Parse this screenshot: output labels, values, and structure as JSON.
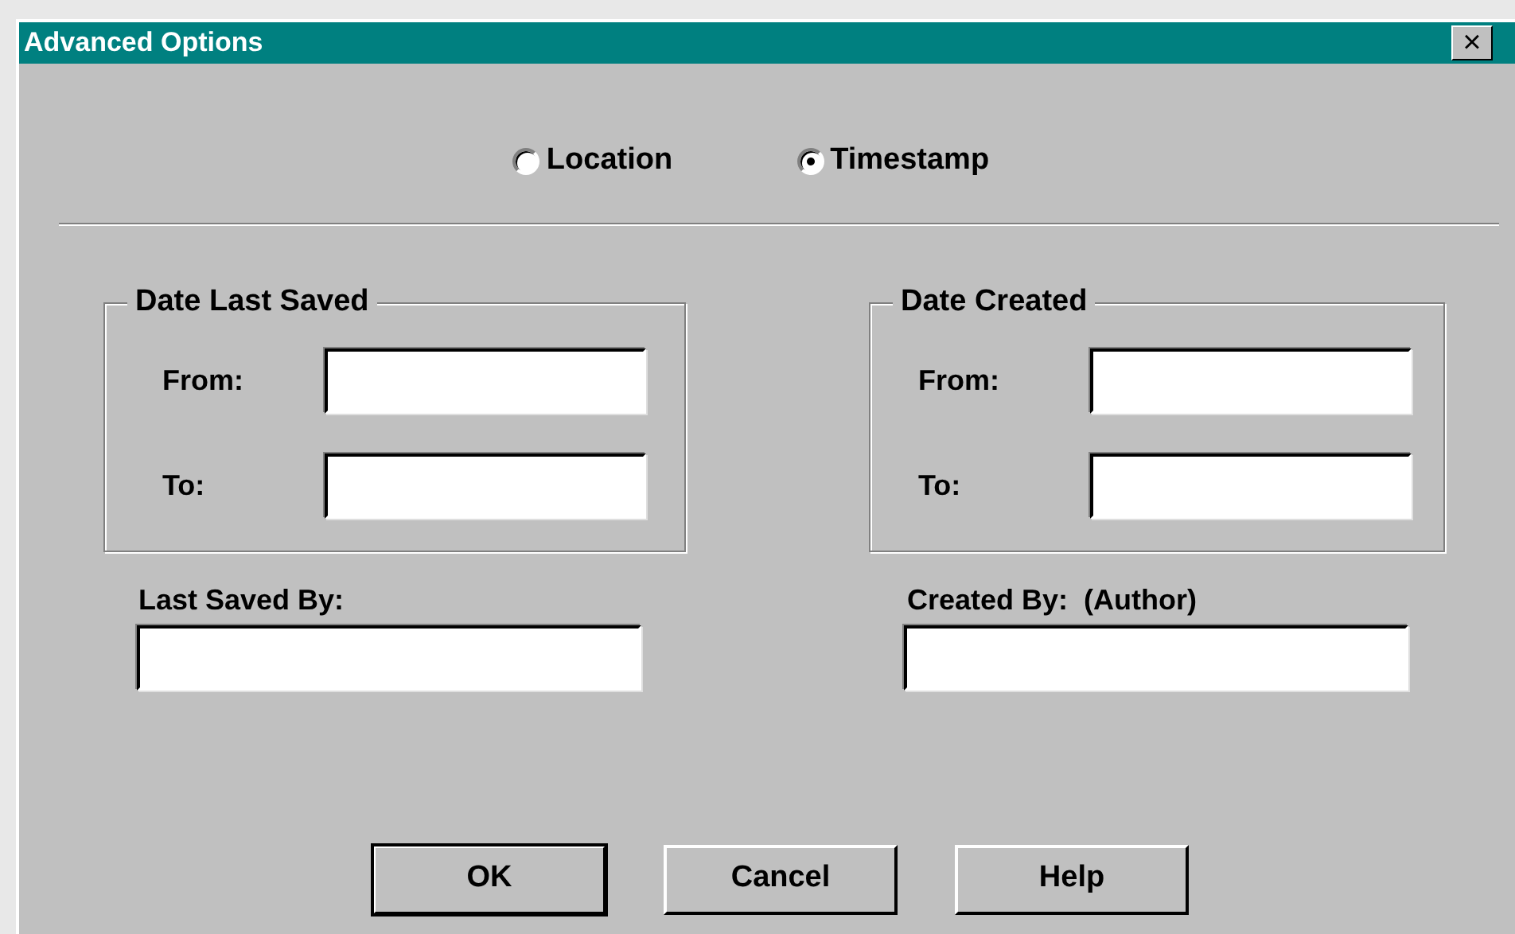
{
  "window": {
    "title": "Advanced Options",
    "close": "×"
  },
  "search_by": [
    {
      "label": "Location",
      "selected": false
    },
    {
      "label": "Timestamp",
      "selected": true
    }
  ],
  "groups": [
    {
      "title": "Date Last Saved",
      "fields": [
        {
          "label": "From:"
        },
        {
          "label": "To:"
        }
      ],
      "person": {
        "label": "Last Saved By:"
      }
    },
    {
      "title": "Date Created",
      "fields": [
        {
          "label": "From:"
        },
        {
          "label": "To:"
        }
      ],
      "person": {
        "label": "Created By:  (Author)"
      }
    }
  ],
  "buttons": [
    {
      "label": "OK",
      "default": true
    },
    {
      "label": "Cancel",
      "default": false
    },
    {
      "label": "Help",
      "default": false
    }
  ]
}
